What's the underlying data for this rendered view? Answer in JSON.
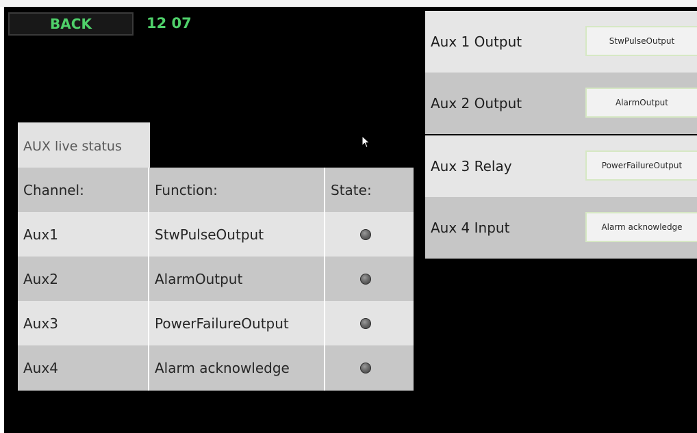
{
  "header": {
    "back_label": "BACK",
    "time": "12 07"
  },
  "aux_config": {
    "rows": [
      {
        "label": "Aux 1 Output",
        "value": "StwPulseOutput"
      },
      {
        "label": "Aux 2 Output",
        "value": "AlarmOutput"
      },
      {
        "label": "Aux 3 Relay",
        "value": "PowerFailureOutput"
      },
      {
        "label": "Aux 4 Input",
        "value": "Alarm acknowledge"
      }
    ]
  },
  "live_status": {
    "title": "AUX live status",
    "columns": [
      "Channel:",
      "Function:",
      "State:"
    ],
    "rows": [
      {
        "channel": "Aux1",
        "function": "StwPulseOutput",
        "state": "off"
      },
      {
        "channel": "Aux2",
        "function": "AlarmOutput",
        "state": "off"
      },
      {
        "channel": "Aux3",
        "function": "PowerFailureOutput",
        "state": "off"
      },
      {
        "channel": "Aux4",
        "function": "Alarm acknowledge",
        "state": "off"
      }
    ]
  },
  "colors": {
    "accent_green": "#4fd06a",
    "background": "#000000",
    "row_light": "#e4e4e4",
    "row_dark": "#c7c7c7",
    "led_off": "#6a6a6a"
  },
  "icons": {
    "state_indicator": "led-indicator-icon",
    "pointer": "mouse-pointer-icon"
  }
}
